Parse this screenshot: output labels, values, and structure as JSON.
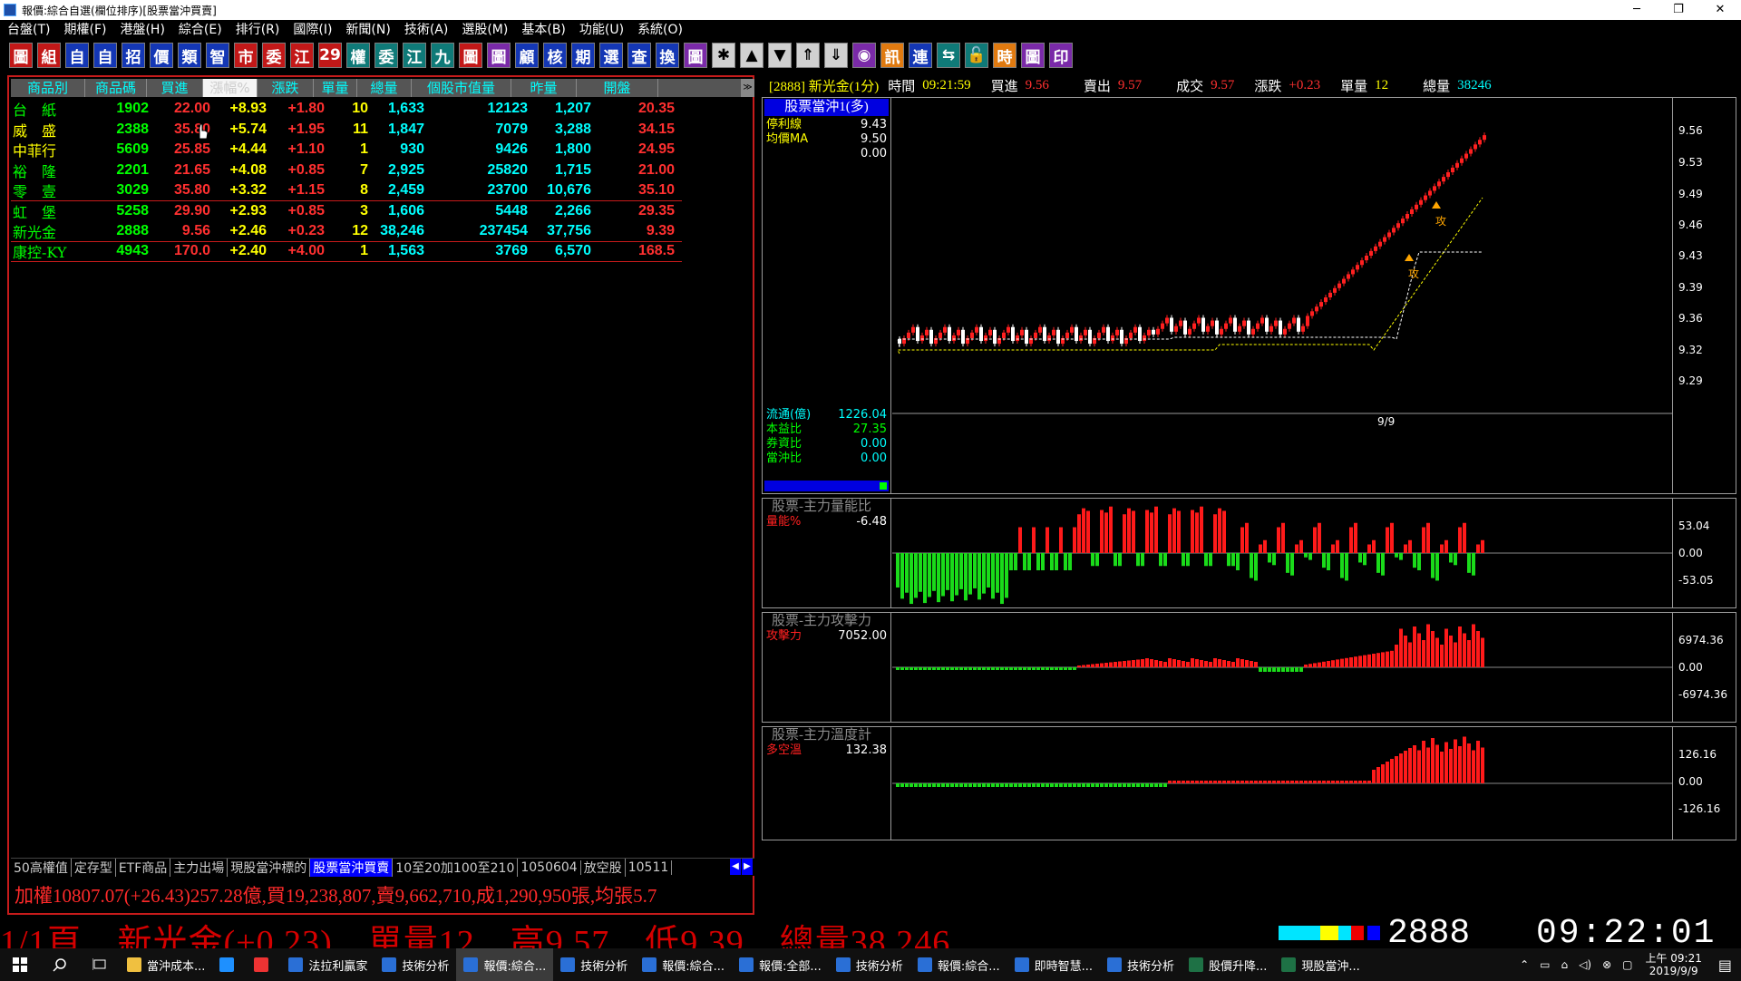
{
  "window": {
    "title": "報價:綜合自選(欄位排序)[股票當沖買賣]",
    "controls": [
      "─",
      "❐",
      "✕"
    ]
  },
  "menu": [
    "台盤(T)",
    "期權(F)",
    "港盤(H)",
    "綜合(E)",
    "排行(R)",
    "國際(I)",
    "新聞(N)",
    "技術(A)",
    "選股(M)",
    "基本(B)",
    "功能(U)",
    "系統(O)"
  ],
  "toolbar": [
    {
      "label": "圖",
      "style": "red"
    },
    {
      "label": "組",
      "style": "red"
    },
    {
      "label": "自",
      "style": "blue"
    },
    {
      "label": "自",
      "style": "blue"
    },
    {
      "label": "招",
      "style": "blue"
    },
    {
      "label": "價",
      "style": "blue"
    },
    {
      "label": "類",
      "style": "blue"
    },
    {
      "label": "智",
      "style": "blue"
    },
    {
      "label": "市",
      "style": "red"
    },
    {
      "label": "委",
      "style": "red"
    },
    {
      "label": "江",
      "style": "red"
    },
    {
      "label": "29",
      "style": "red"
    },
    {
      "label": "權",
      "style": "teal"
    },
    {
      "label": "委",
      "style": "teal"
    },
    {
      "label": "江",
      "style": "teal"
    },
    {
      "label": "九",
      "style": "teal"
    },
    {
      "label": "圖",
      "style": "red"
    },
    {
      "label": "圖",
      "style": "purple"
    },
    {
      "label": "顧",
      "style": "blue"
    },
    {
      "label": "核",
      "style": "blue"
    },
    {
      "label": "期",
      "style": "blue"
    },
    {
      "label": "選",
      "style": "blue"
    },
    {
      "label": "查",
      "style": "blue"
    },
    {
      "label": "換",
      "style": "blue"
    },
    {
      "label": "圖",
      "style": "purple"
    },
    {
      "label": "✱",
      "style": "gray"
    },
    {
      "label": "▲",
      "style": "gray"
    },
    {
      "label": "▼",
      "style": "gray"
    },
    {
      "label": "⇑",
      "style": "gray"
    },
    {
      "label": "⇓",
      "style": "gray"
    },
    {
      "label": "◉",
      "style": "purple"
    },
    {
      "label": "訊",
      "style": "orange"
    },
    {
      "label": "連",
      "style": "blue"
    },
    {
      "label": "⇆",
      "style": "teal"
    },
    {
      "label": "🔓",
      "style": "teal"
    },
    {
      "label": "時",
      "style": "orange"
    },
    {
      "label": "圖",
      "style": "purple"
    },
    {
      "label": "印",
      "style": "purple"
    }
  ],
  "quote_table": {
    "headers": [
      "商品別",
      "商品碼",
      "買進",
      "漲幅%",
      "漲跌",
      "單量",
      "總量",
      "個股市值量",
      "昨量",
      "開盤"
    ],
    "rows": [
      {
        "name": "台　紙",
        "code": "1902",
        "bid": "22.00",
        "pct": "+8.93",
        "chg": "+1.80",
        "unit": "10",
        "vol": "1,633",
        "cap": "12123",
        "yvol": "1,207",
        "open": "20.35",
        "nc": "#00ff00",
        "bc": "#ff3030",
        "sep": false
      },
      {
        "name": "威　盛",
        "code": "2388",
        "bid": "35.80",
        "pct": "+5.74",
        "chg": "+1.95",
        "unit": "11",
        "vol": "1,847",
        "cap": "7079",
        "yvol": "3,288",
        "open": "34.15",
        "nc": "#ffff00",
        "bc": "#ff3030",
        "sep": false
      },
      {
        "name": "中菲行",
        "code": "5609",
        "bid": "25.85",
        "pct": "+4.44",
        "chg": "+1.10",
        "unit": "1",
        "vol": "930",
        "cap": "9426",
        "yvol": "1,800",
        "open": "24.95",
        "nc": "#ffff00",
        "bc": "#ff3030",
        "sep": false
      },
      {
        "name": "裕　隆",
        "code": "2201",
        "bid": "21.65",
        "pct": "+4.08",
        "chg": "+0.85",
        "unit": "7",
        "vol": "2,925",
        "cap": "25820",
        "yvol": "1,715",
        "open": "21.00",
        "nc": "#00ff00",
        "bc": "#ff3030",
        "sep": false
      },
      {
        "name": "零　壹",
        "code": "3029",
        "bid": "35.80",
        "pct": "+3.32",
        "chg": "+1.15",
        "unit": "8",
        "vol": "2,459",
        "cap": "23700",
        "yvol": "10,676",
        "open": "35.10",
        "nc": "#00ff00",
        "bc": "#ff3030",
        "sep": true
      },
      {
        "name": "虹　堡",
        "code": "5258",
        "bid": "29.90",
        "pct": "+2.93",
        "chg": "+0.85",
        "unit": "3",
        "vol": "1,606",
        "cap": "5448",
        "yvol": "2,266",
        "open": "29.35",
        "nc": "#00ff00",
        "bc": "#ff3030",
        "sep": false
      },
      {
        "name": "新光金",
        "code": "2888",
        "bid": "9.56",
        "pct": "+2.46",
        "chg": "+0.23",
        "unit": "12",
        "vol": "38,246",
        "cap": "237454",
        "yvol": "37,756",
        "open": "9.39",
        "nc": "#00ff00",
        "bc": "#ff3030",
        "sep": true
      },
      {
        "name": "康控-KY",
        "code": "4943",
        "bid": "170.0",
        "pct": "+2.40",
        "chg": "+4.00",
        "unit": "1",
        "vol": "1,563",
        "cap": "3769",
        "yvol": "6,570",
        "open": "168.5",
        "nc": "#00ff00",
        "bc": "#ff3030",
        "sep": true
      }
    ]
  },
  "tabs": [
    "50高權值",
    "定存型",
    "ETF商品",
    "主力出場",
    "現股當沖標的",
    "股票當沖買賣",
    "10至20加100至210",
    "1050604",
    "放空股",
    "10511"
  ],
  "tabs_active": 5,
  "ticker_text": "加權10807.07(+26.43)257.28億,買19,238,807,賣9,662,710,成1,290,950張,均張5.7",
  "infobar": {
    "stock": "[2888] 新光金(1分)",
    "time_label": "時間",
    "time": "09:21:59",
    "bid_label": "買進",
    "bid": "9.56",
    "ask_label": "賣出",
    "ask": "9.57",
    "deal_label": "成交",
    "deal": "9.57",
    "chg_label": "漲跌",
    "chg": "+0.23",
    "unit_label": "單量",
    "unit": "12",
    "vol_label": "總量",
    "vol": "38246"
  },
  "price_pane": {
    "title": "股票當沖1(多)",
    "stop_label": "停利線",
    "stop": "9.43",
    "ma_label": "均價MA",
    "ma": "9.50",
    "extra": "0.00",
    "float_label": "流通(億)",
    "float": "1226.04",
    "pe_label": "本益比",
    "pe": "27.35",
    "margin_label": "券資比",
    "margin": "0.00",
    "daytrade_label": "當沖比",
    "daytrade": "0.00",
    "date": "9/9",
    "marker": "攻",
    "axis": [
      "9.56",
      "9.53",
      "9.49",
      "9.46",
      "9.43",
      "9.39",
      "9.36",
      "9.32",
      "9.29"
    ]
  },
  "vol_pane": {
    "title": "股票-主力量能比",
    "label": "量能%",
    "value": "-6.48",
    "axis": [
      "53.04",
      "0.00",
      "-53.05"
    ]
  },
  "attack_pane": {
    "title": "股票-主力攻擊力",
    "label": "攻擊力",
    "value": "7052.00",
    "axis": [
      "6974.36",
      "0.00",
      "-6974.36"
    ]
  },
  "temp_pane": {
    "title": "股票-主力溫度計",
    "label": "多空溫",
    "value": "132.38",
    "axis": [
      "126.16",
      "0.00",
      "-126.16"
    ]
  },
  "status_bar": {
    "marquee": "1/1頁　新光金(+0.23)　單量12　高9.57　低9.39　總量38,246",
    "code": "2888",
    "clock": "09:22:01"
  },
  "taskbar": {
    "items": [
      {
        "label": "當沖成本...",
        "icon": "folder-icon",
        "color": "#f0c040"
      },
      {
        "label": "",
        "icon": "ie-icon",
        "color": "#1e90ff"
      },
      {
        "label": "",
        "icon": "chrome-icon",
        "color": "#e33"
      },
      {
        "label": "法拉利贏家",
        "icon": "app-icon",
        "color": "#2a6fd6"
      },
      {
        "label": "技術分析",
        "icon": "chart-icon",
        "color": "#2a6fd6"
      },
      {
        "label": "報價:綜合...",
        "icon": "chart-icon",
        "color": "#2a6fd6"
      },
      {
        "label": "技術分析",
        "icon": "chart-icon",
        "color": "#2a6fd6"
      },
      {
        "label": "報價:綜合...",
        "icon": "chart-icon",
        "color": "#2a6fd6"
      },
      {
        "label": "報價:全部...",
        "icon": "chart-icon",
        "color": "#2a6fd6"
      },
      {
        "label": "技術分析",
        "icon": "chart-icon",
        "color": "#2a6fd6"
      },
      {
        "label": "報價:綜合...",
        "icon": "chart-icon",
        "color": "#2a6fd6"
      },
      {
        "label": "即時智慧...",
        "icon": "chart-icon",
        "color": "#2a6fd6"
      },
      {
        "label": "技術分析",
        "icon": "chart-icon",
        "color": "#2a6fd6"
      },
      {
        "label": "股價升降...",
        "icon": "excel-icon",
        "color": "#1e7145"
      },
      {
        "label": "現股當沖...",
        "icon": "excel-icon",
        "color": "#1e7145"
      }
    ],
    "active": 5,
    "clock_time": "上午 09:21",
    "clock_date": "2019/9/9"
  }
}
